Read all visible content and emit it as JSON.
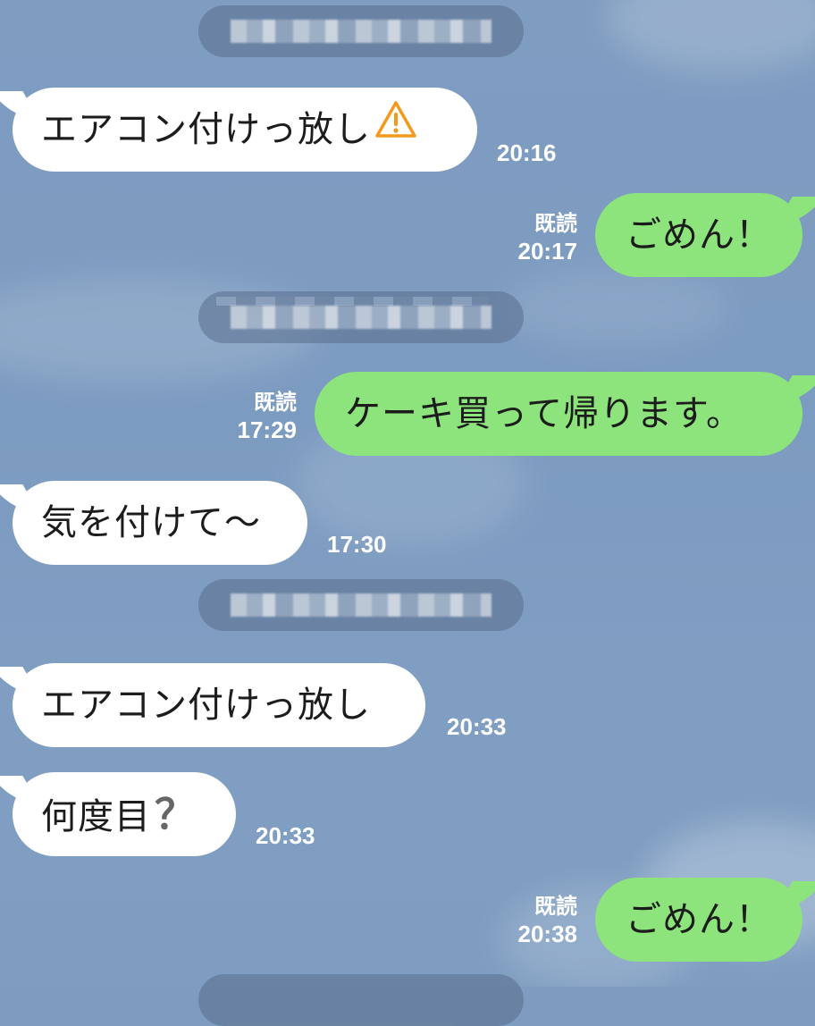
{
  "messages": [
    {
      "side": "in",
      "text": "エアコン付けっ放し",
      "icon": "warning-icon",
      "time": "20:16"
    },
    {
      "side": "out",
      "text": "ごめん！",
      "read": "既読",
      "time": "20:17"
    },
    {
      "side": "out",
      "text": "ケーキ買って帰ります。",
      "read": "既読",
      "time": "17:29"
    },
    {
      "side": "in",
      "text": "気を付けて〜",
      "time": "17:30"
    },
    {
      "side": "in",
      "text": "エアコン付けっ放し",
      "time": "20:33"
    },
    {
      "side": "in",
      "text": "何度目",
      "icon": "question-icon",
      "icon_glyph": "？",
      "time": "20:33"
    },
    {
      "side": "out",
      "text": "ごめん！",
      "read": "既読",
      "time": "20:38"
    }
  ],
  "colors": {
    "background": "#7d9cc0",
    "incoming_bubble": "#ffffff",
    "outgoing_bubble": "#8de47c",
    "warning": "#f39a1e"
  }
}
